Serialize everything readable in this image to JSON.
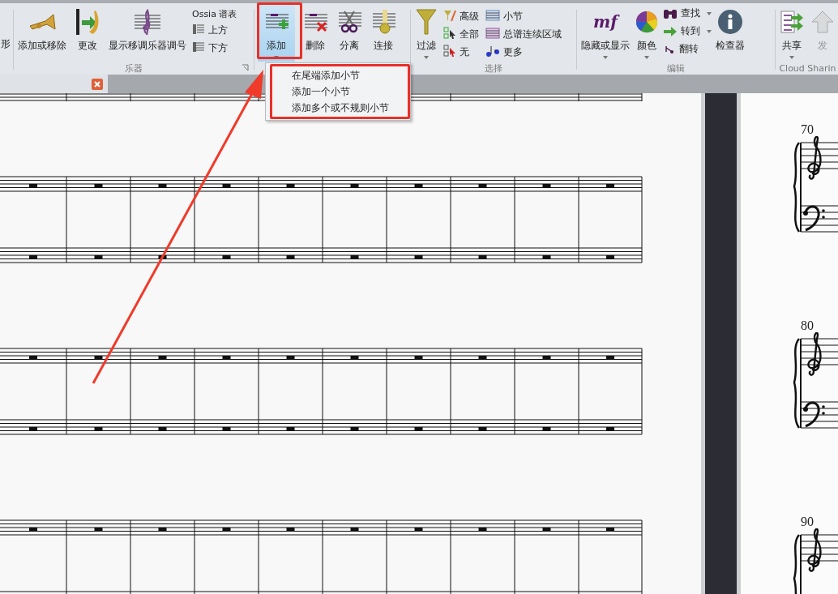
{
  "ribbon": {
    "partial_label": "形",
    "instruments": {
      "label": "乐器",
      "buttons": [
        {
          "label": "添加或移除"
        },
        {
          "label": "更改"
        },
        {
          "label": "显示移调乐器调号"
        }
      ],
      "ossia": {
        "title": "Ossia 谱表",
        "items": [
          "上方",
          "下方"
        ]
      }
    },
    "measures": {
      "buttons": [
        {
          "label": "添加",
          "selected": true,
          "dropdown": true
        },
        {
          "label": "删除",
          "selected": false,
          "dropdown": false
        },
        {
          "label": "分离",
          "selected": false,
          "dropdown": false
        },
        {
          "label": "连接",
          "selected": false,
          "dropdown": false
        }
      ]
    },
    "selection": {
      "label": "选择",
      "filter": {
        "label": "过滤",
        "dropdown": true
      },
      "items": [
        {
          "label": "高级"
        },
        {
          "label": "全部"
        },
        {
          "label": "无"
        },
        {
          "label": "小节"
        },
        {
          "label": "总谱连续区域"
        },
        {
          "label": "更多"
        }
      ]
    },
    "edit": {
      "label": "编辑",
      "hide_show": {
        "label": "隐藏或显示",
        "icon_text": "mf",
        "dropdown": true
      },
      "color": {
        "label": "颜色",
        "dropdown": true
      },
      "items": [
        {
          "label": "查找",
          "dropdown": true
        },
        {
          "label": "转到",
          "dropdown": true
        },
        {
          "label": "翻转",
          "dropdown": false
        }
      ],
      "inspector": {
        "label": "检查器"
      }
    },
    "cloud": {
      "label": "Cloud Sharin",
      "buttons": [
        {
          "label": "共享",
          "dropdown": true,
          "disabled": false
        },
        {
          "label": "发",
          "dropdown": false,
          "disabled": true
        }
      ]
    }
  },
  "dropdown_menu": {
    "items": [
      "在尾端添加小节",
      "添加一个小节",
      "添加多个或不规则小节"
    ]
  },
  "score": {
    "measure_numbers": [
      "70",
      "80",
      "90"
    ]
  }
}
